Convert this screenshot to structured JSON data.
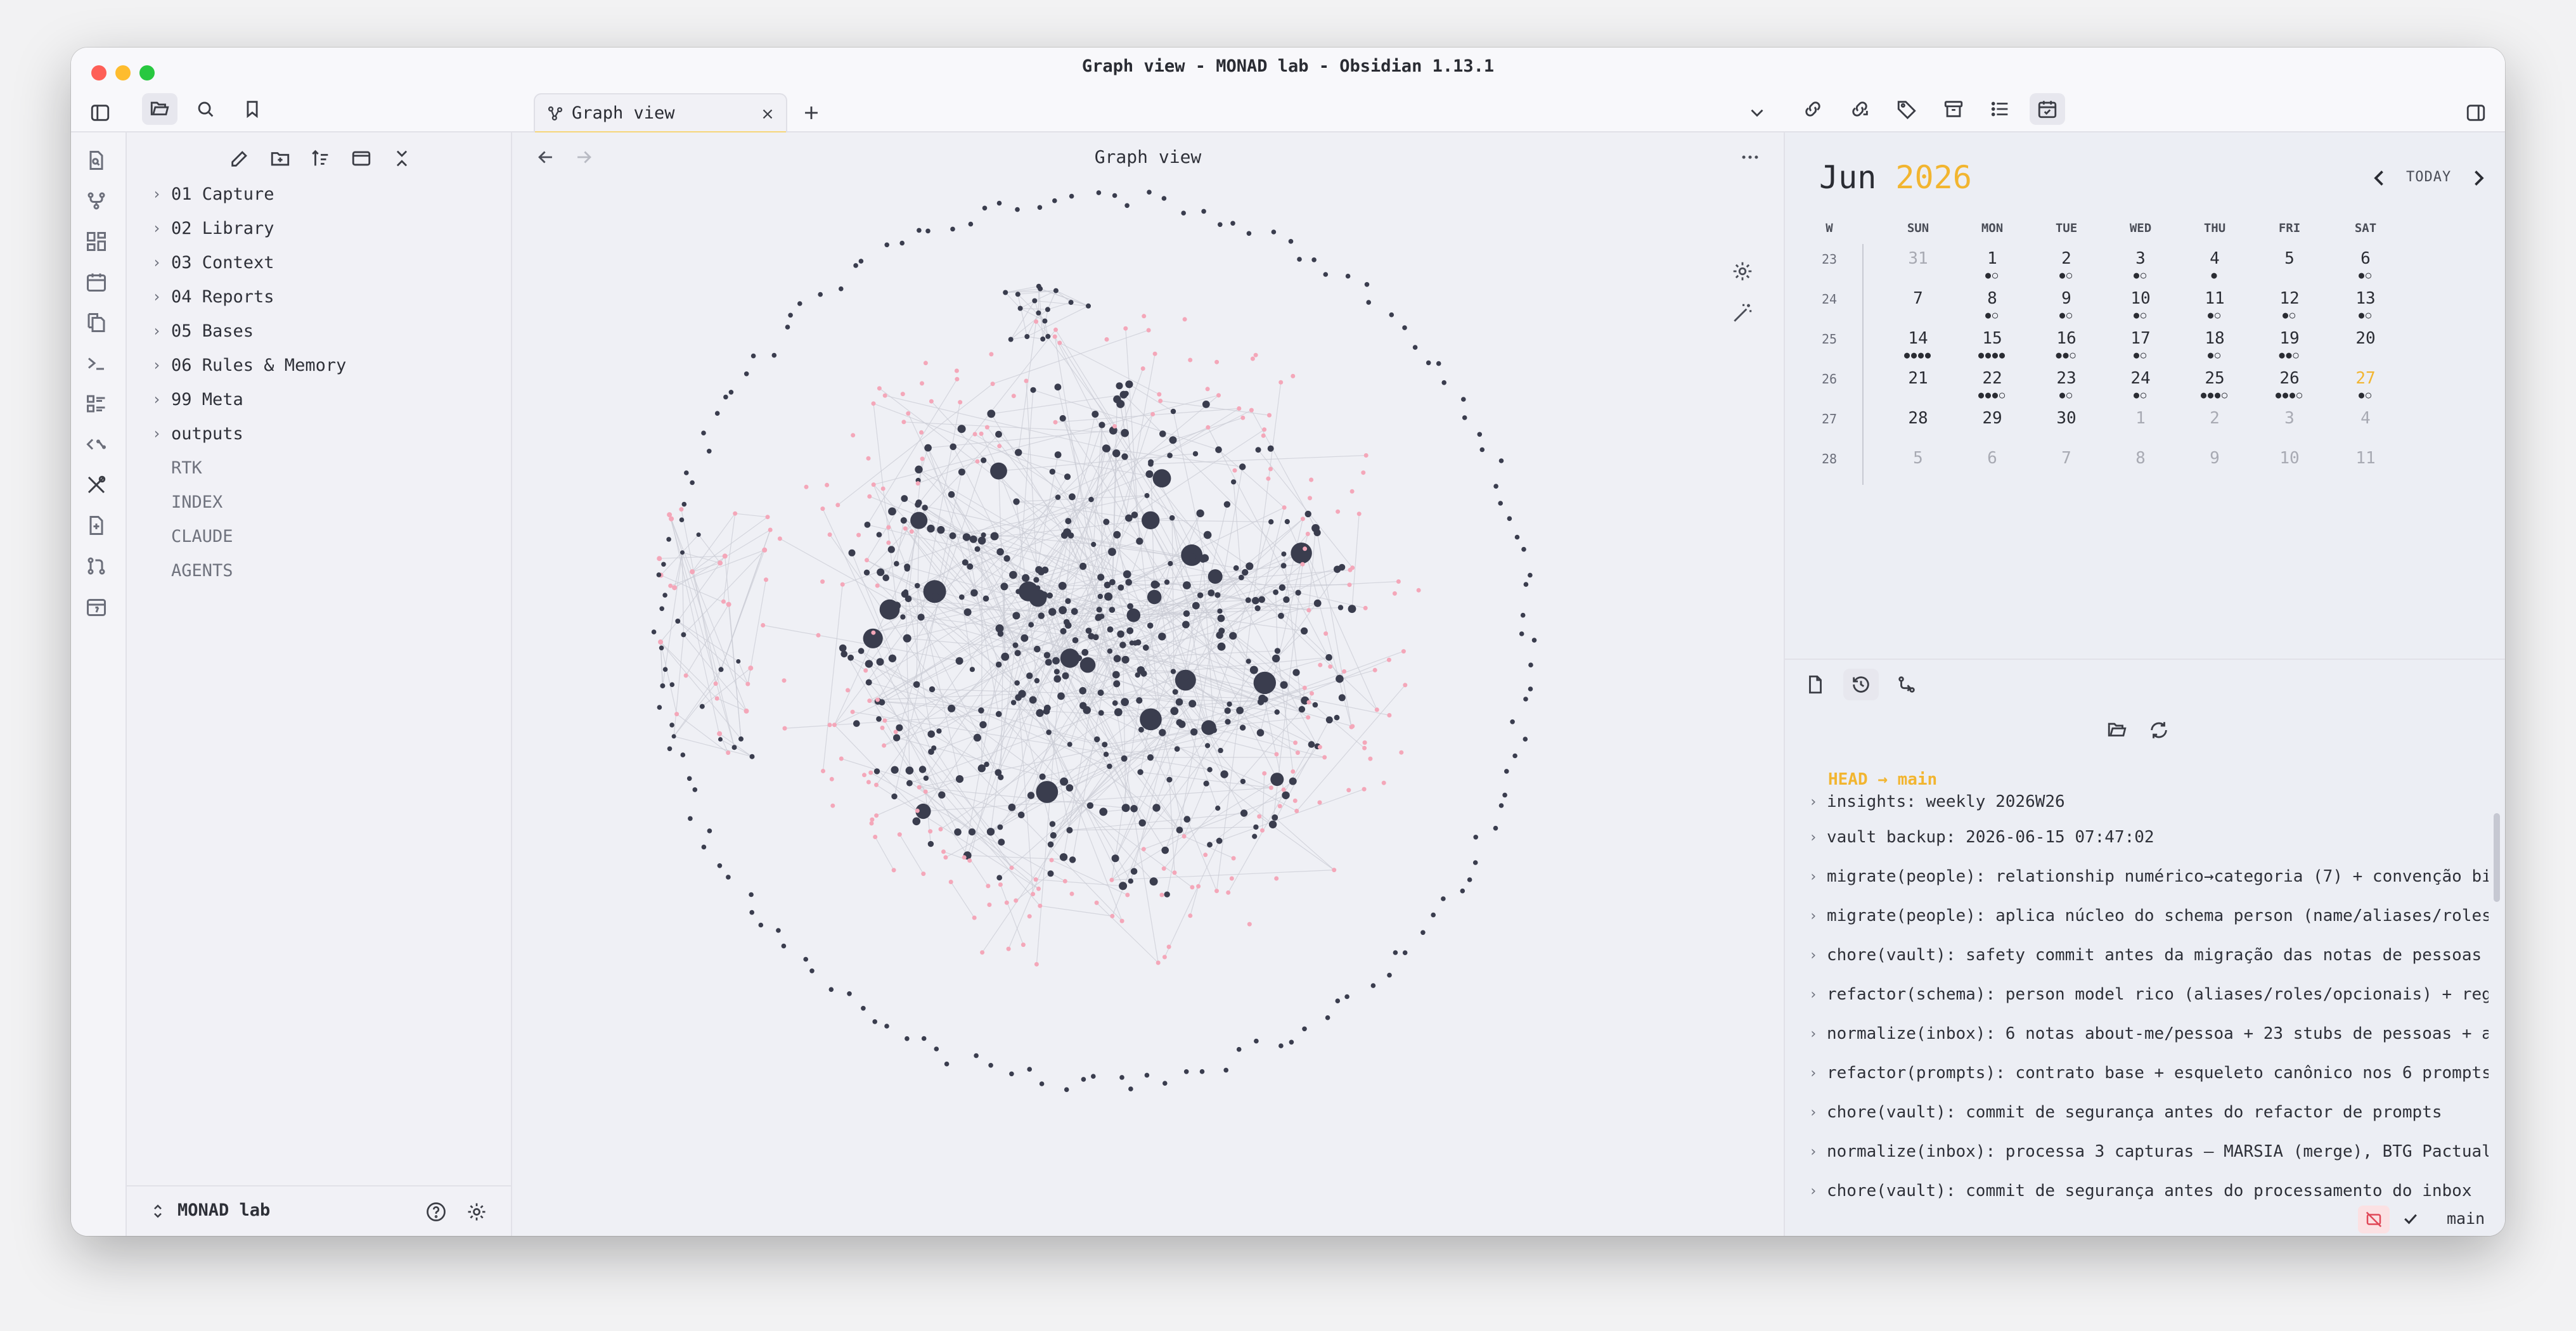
{
  "window": {
    "title": "Graph view - MONAD lab - Obsidian 1.13.1",
    "traffic_colors": [
      "#fe5f57",
      "#febc2e",
      "#28c840"
    ]
  },
  "tabs": [
    {
      "label": "Graph view",
      "icon": "graph-icon"
    }
  ],
  "sidebar": {
    "folders": [
      {
        "label": "01 Capture"
      },
      {
        "label": "02 Library"
      },
      {
        "label": "03 Context"
      },
      {
        "label": "04 Reports"
      },
      {
        "label": "05 Bases"
      },
      {
        "label": "06 Rules & Memory"
      },
      {
        "label": "99 Meta"
      },
      {
        "label": "outputs"
      }
    ],
    "files": [
      {
        "label": "RTK"
      },
      {
        "label": "INDEX"
      },
      {
        "label": "CLAUDE"
      },
      {
        "label": "AGENTS"
      }
    ],
    "vault_name": "MONAD lab"
  },
  "graph": {
    "title": "Graph view",
    "colors": {
      "node": "#3a3d4e",
      "orphan_node": "#f4a7b9",
      "edge": "#c9cbd4"
    }
  },
  "calendar": {
    "month": "Jun",
    "year": "2026",
    "today_label": "TODAY",
    "headers": [
      "W",
      "SUN",
      "MON",
      "TUE",
      "WED",
      "THU",
      "FRI",
      "SAT"
    ],
    "weeks": [
      {
        "w": "23",
        "days": [
          {
            "d": "31",
            "muted": true,
            "dots": ""
          },
          {
            "d": "1",
            "dots": "●○"
          },
          {
            "d": "2",
            "dots": "●○"
          },
          {
            "d": "3",
            "dots": "●○"
          },
          {
            "d": "4",
            "dots": "●"
          },
          {
            "d": "5",
            "dots": ""
          },
          {
            "d": "6",
            "dots": "●○"
          }
        ]
      },
      {
        "w": "24",
        "days": [
          {
            "d": "7",
            "dots": ""
          },
          {
            "d": "8",
            "dots": "●○"
          },
          {
            "d": "9",
            "dots": "●○"
          },
          {
            "d": "10",
            "dots": "●○"
          },
          {
            "d": "11",
            "dots": "●○"
          },
          {
            "d": "12",
            "dots": "●○"
          },
          {
            "d": "13",
            "dots": "●○"
          }
        ]
      },
      {
        "w": "25",
        "days": [
          {
            "d": "14",
            "dots": "●●●●"
          },
          {
            "d": "15",
            "dots": "●●●●"
          },
          {
            "d": "16",
            "dots": "●●○"
          },
          {
            "d": "17",
            "dots": "●○"
          },
          {
            "d": "18",
            "dots": "●○"
          },
          {
            "d": "19",
            "dots": "●●○"
          },
          {
            "d": "20",
            "dots": ""
          }
        ]
      },
      {
        "w": "26",
        "days": [
          {
            "d": "21",
            "dots": ""
          },
          {
            "d": "22",
            "dots": "●●●○"
          },
          {
            "d": "23",
            "dots": "●○"
          },
          {
            "d": "24",
            "dots": "●○"
          },
          {
            "d": "25",
            "dots": "●●●○"
          },
          {
            "d": "26",
            "dots": "●●●○"
          },
          {
            "d": "27",
            "today": true,
            "dots": "●○"
          }
        ]
      },
      {
        "w": "27",
        "days": [
          {
            "d": "28",
            "dots": ""
          },
          {
            "d": "29",
            "dots": ""
          },
          {
            "d": "30",
            "dots": ""
          },
          {
            "d": "1",
            "muted": true,
            "dots": ""
          },
          {
            "d": "2",
            "muted": true,
            "dots": ""
          },
          {
            "d": "3",
            "muted": true,
            "dots": ""
          },
          {
            "d": "4",
            "muted": true,
            "dots": ""
          }
        ]
      },
      {
        "w": "28",
        "days": [
          {
            "d": "5",
            "muted": true,
            "dots": ""
          },
          {
            "d": "6",
            "muted": true,
            "dots": ""
          },
          {
            "d": "7",
            "muted": true,
            "dots": ""
          },
          {
            "d": "8",
            "muted": true,
            "dots": ""
          },
          {
            "d": "9",
            "muted": true,
            "dots": ""
          },
          {
            "d": "10",
            "muted": true,
            "dots": ""
          },
          {
            "d": "11",
            "muted": true,
            "dots": ""
          }
        ]
      }
    ]
  },
  "git": {
    "head_label": "HEAD → main",
    "commits": [
      "insights: weekly 2026W26",
      "vault backup: 2026-06-15 07:47:02",
      "migrate(people): relationship numérico→categoria (7) + convenção bi",
      "migrate(people): aplica núcleo do schema person (name/aliases/roles",
      "chore(vault): safety commit antes da migração das notas de pessoas",
      "refactor(schema): person model rico (aliases/roles/opcionais) + reg",
      "normalize(inbox): 6 notas about-me/pessoa + 23 stubs de pessoas + a",
      "refactor(prompts): contrato base + esqueleto canônico nos 6 prompts",
      "chore(vault): commit de segurança antes do refactor de prompts",
      "normalize(inbox): processa 3 capturas — MARSIA (merge), BTG Pactual",
      "chore(vault): commit de segurança antes do processamento do inbox"
    ],
    "branch": "main"
  }
}
